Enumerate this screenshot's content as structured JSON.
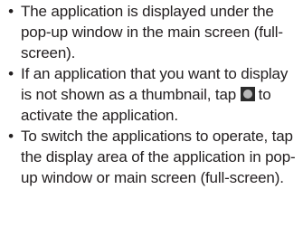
{
  "bullet_char": "•",
  "items": [
    {
      "text": "The application is displayed under the pop-up window in the main screen (full-screen)."
    },
    {
      "text_before": "If an application that you want to display is not shown as a thumbnail, tap ",
      "icon": "home-circle-button-icon",
      "text_after": "to activate the application."
    },
    {
      "text": "To switch the applications to operate, tap the display area of the application in pop-up window or main screen (full-screen)."
    }
  ],
  "colors": {
    "text": "#231f20",
    "icon_background": "#2b2b2b",
    "icon_circle": "#b8b8b8"
  }
}
